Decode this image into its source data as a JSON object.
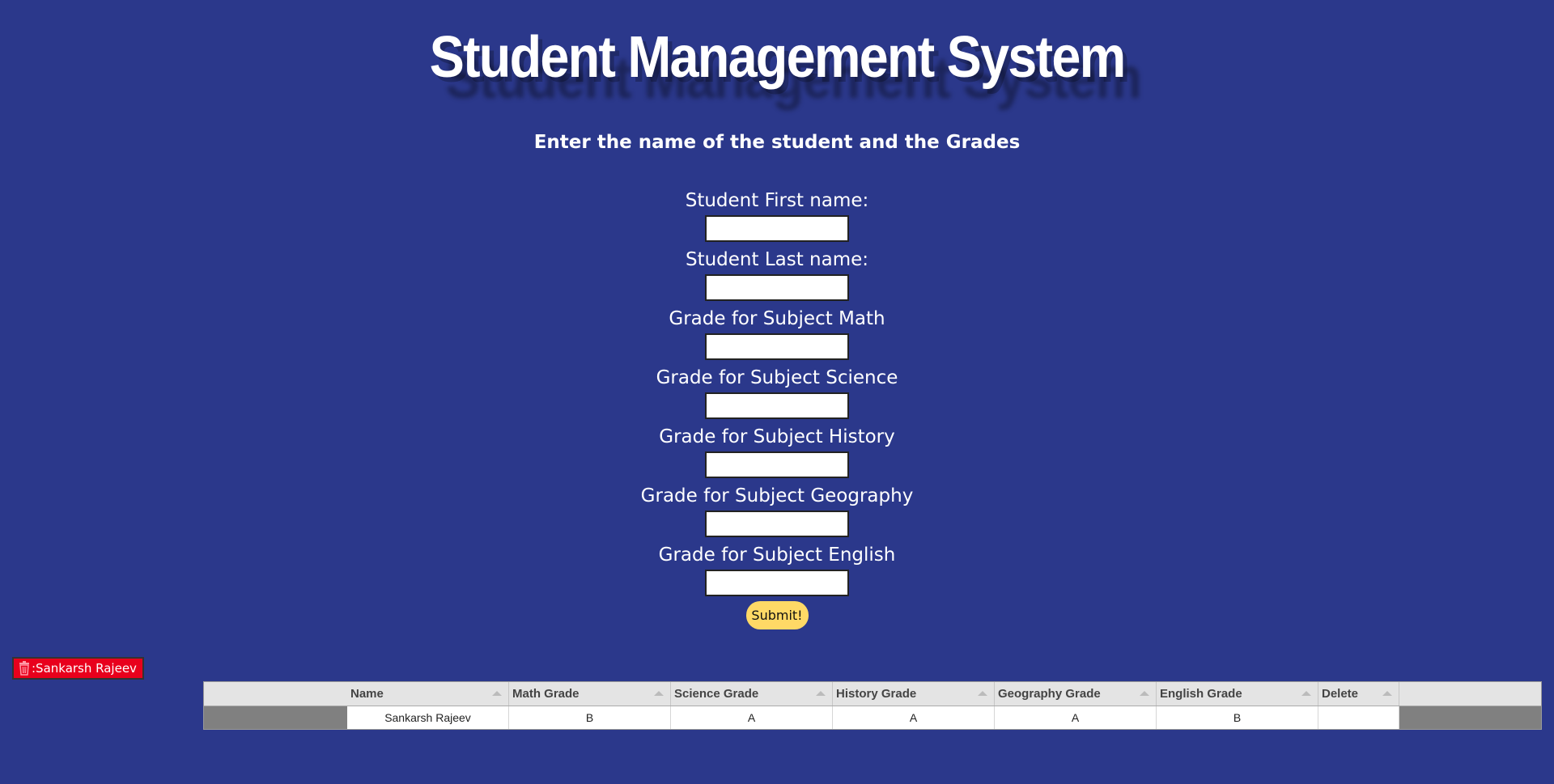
{
  "page": {
    "title": "Student Management System",
    "subtitle": "Enter the name of the student and the Grades",
    "background_color": "#2b388b"
  },
  "form": {
    "fields": [
      {
        "label": "Student First name:",
        "value": ""
      },
      {
        "label": "Student Last name:",
        "value": ""
      },
      {
        "label": "Grade for Subject Math",
        "value": ""
      },
      {
        "label": "Grade for Subject Science",
        "value": ""
      },
      {
        "label": "Grade for Subject History",
        "value": ""
      },
      {
        "label": "Grade for Subject Geography",
        "value": ""
      },
      {
        "label": "Grade for Subject English",
        "value": ""
      }
    ],
    "submit_label": "Submit!",
    "submit_color": "#ffd966"
  },
  "student_chip": {
    "icon": "trash-icon",
    "label": ":Sankarsh Rajeev",
    "color": "#e8001c"
  },
  "table": {
    "columns": [
      "Name",
      "Math Grade",
      "Science Grade",
      "History Grade",
      "Geography Grade",
      "English Grade",
      "Delete"
    ],
    "rows": [
      [
        "Sankarsh Rajeev",
        "B",
        "A",
        "A",
        "A",
        "B",
        ""
      ]
    ]
  }
}
